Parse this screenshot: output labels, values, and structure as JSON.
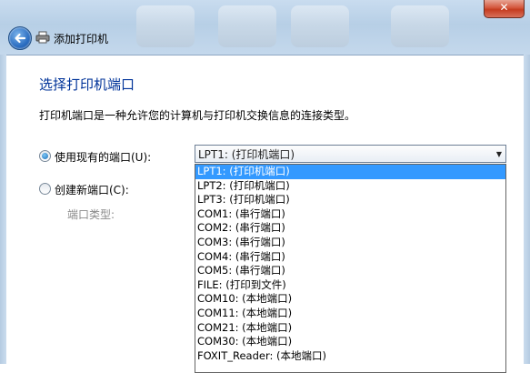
{
  "window": {
    "close_label": "✕"
  },
  "wizard": {
    "title": "添加打印机"
  },
  "page": {
    "heading": "选择打印机端口",
    "description": "打印机端口是一种允许您的计算机与打印机交换信息的连接类型。"
  },
  "options": {
    "use_existing_label": "使用现有的端口(U):",
    "create_new_label": "创建新端口(C):",
    "port_type_label": "端口类型:"
  },
  "port_select": {
    "selected": "LPT1: (打印机端口)",
    "items": [
      "LPT1: (打印机端口)",
      "LPT2: (打印机端口)",
      "LPT3: (打印机端口)",
      "COM1: (串行端口)",
      "COM2: (串行端口)",
      "COM3: (串行端口)",
      "COM4: (串行端口)",
      "COM5: (串行端口)",
      "FILE: (打印到文件)",
      "COM10: (本地端口)",
      "COM11: (本地端口)",
      "COM21: (本地端口)",
      "COM30: (本地端口)",
      "FOXIT_Reader: (本地端口)"
    ]
  }
}
